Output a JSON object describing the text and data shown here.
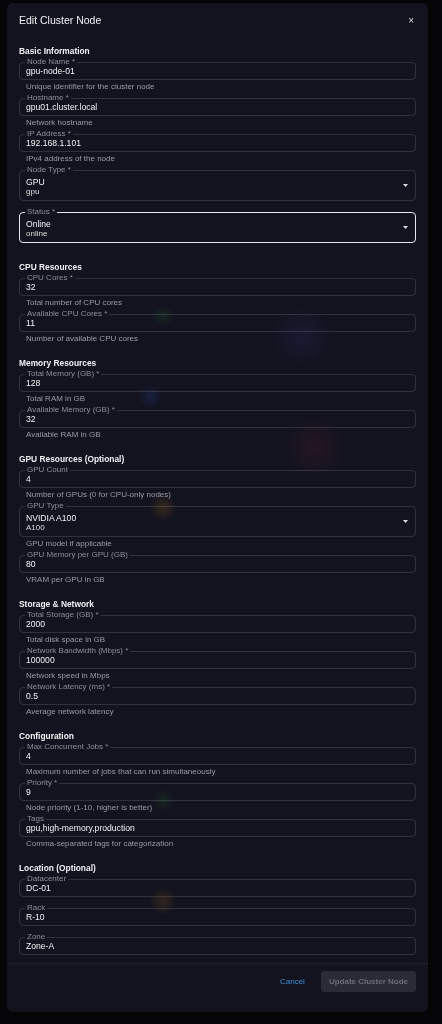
{
  "dialog": {
    "title": "Edit Cluster Node",
    "close": "×"
  },
  "sections": [
    {
      "title": "Basic Information",
      "fields": [
        {
          "kind": "text",
          "label": "Node Name *",
          "value": "gpu-node-01",
          "helper": "Unique identifier for the cluster node",
          "focused": false
        },
        {
          "kind": "text",
          "label": "Hostname *",
          "value": "gpu01.cluster.local",
          "helper": "Network hostname",
          "focused": false
        },
        {
          "kind": "text",
          "label": "IP Address *",
          "value": "192.168.1.101",
          "helper": "IPv4 address of the node",
          "focused": false
        },
        {
          "kind": "select",
          "label": "Node Type *",
          "value": "GPU",
          "subvalue": "gpu",
          "focused": false
        },
        {
          "kind": "select",
          "label": "Status *",
          "value": "Online",
          "subvalue": "online",
          "focused": true
        }
      ]
    },
    {
      "title": "CPU Resources",
      "fields": [
        {
          "kind": "text",
          "label": "CPU Cores *",
          "value": "32",
          "helper": "Total number of CPU cores",
          "focused": false
        },
        {
          "kind": "text",
          "label": "Available CPU Cores *",
          "value": "11",
          "helper": "Number of available CPU cores",
          "focused": false
        }
      ]
    },
    {
      "title": "Memory Resources",
      "fields": [
        {
          "kind": "text",
          "label": "Total Memory (GB) *",
          "value": "128",
          "helper": "Total RAM in GB",
          "focused": false
        },
        {
          "kind": "text",
          "label": "Available Memory (GB) *",
          "value": "32",
          "helper": "Available RAM in GB",
          "focused": false
        }
      ]
    },
    {
      "title": "GPU Resources (Optional)",
      "fields": [
        {
          "kind": "text",
          "label": "GPU Count",
          "value": "4",
          "helper": "Number of GPUs (0 for CPU-only nodes)",
          "focused": false
        },
        {
          "kind": "select",
          "label": "GPU Type",
          "value": "NVIDIA A100",
          "subvalue": "A100",
          "helper": "GPU model if applicable",
          "focused": false
        },
        {
          "kind": "text",
          "label": "GPU Memory per GPU (GB)",
          "value": "80",
          "helper": "VRAM per GPU in GB",
          "focused": false
        }
      ]
    },
    {
      "title": "Storage & Network",
      "fields": [
        {
          "kind": "text",
          "label": "Total Storage (GB) *",
          "value": "2000",
          "helper": "Total disk space in GB",
          "focused": false
        },
        {
          "kind": "text",
          "label": "Network Bandwidth (Mbps) *",
          "value": "100000",
          "helper": "Network speed in Mbps",
          "focused": false
        },
        {
          "kind": "text",
          "label": "Network Latency (ms) *",
          "value": "0.5",
          "helper": "Average network latency",
          "focused": false
        }
      ]
    },
    {
      "title": "Configuration",
      "fields": [
        {
          "kind": "text",
          "label": "Max Concurrent Jobs *",
          "value": "4",
          "helper": "Maximum number of jobs that can run simultaneously",
          "focused": false
        },
        {
          "kind": "text",
          "label": "Priority *",
          "value": "9",
          "helper": "Node priority (1-10, higher is better)",
          "focused": false
        },
        {
          "kind": "text",
          "label": "Tags",
          "value": "gpu,high-memory,production",
          "helper": "Comma-separated tags for categorization",
          "focused": false
        }
      ]
    },
    {
      "title": "Location (Optional)",
      "fields": [
        {
          "kind": "text",
          "label": "Datacenter",
          "value": "DC-01",
          "focused": false
        },
        {
          "kind": "text",
          "label": "Rack",
          "value": "R-10",
          "focused": false
        },
        {
          "kind": "text",
          "label": "Zone",
          "value": "Zone-A",
          "focused": false
        }
      ]
    }
  ],
  "actions": [
    {
      "label": "Cancel",
      "kind": "text",
      "disabled": false
    },
    {
      "label": "Update Cluster Node",
      "kind": "contained",
      "disabled": true
    }
  ]
}
